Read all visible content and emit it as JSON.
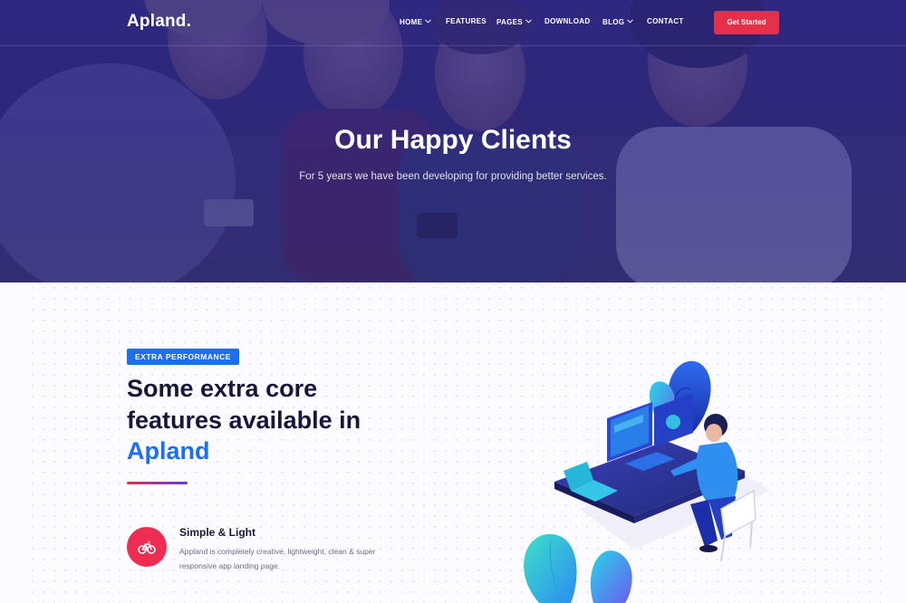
{
  "header": {
    "logo": "Apland.",
    "nav": [
      {
        "label": "HOME",
        "dropdown": true
      },
      {
        "label": "FEATURES",
        "dropdown": false
      },
      {
        "label": "PAGES",
        "dropdown": true
      },
      {
        "label": "DOWNLOAD",
        "dropdown": false
      },
      {
        "label": "BLOG",
        "dropdown": true
      },
      {
        "label": "CONTACT",
        "dropdown": false
      }
    ],
    "cta_label": "Get Started"
  },
  "hero": {
    "title": "Our Happy Clients",
    "subtitle": "For 5 years we have been developing for providing better services."
  },
  "features": {
    "badge": "EXTRA PERFORMANCE",
    "title_line1": "Some extra core",
    "title_line2": "features available in",
    "title_accent": "Apland",
    "card": {
      "icon": "bicycle-icon",
      "title": "Simple & Light",
      "description": "Appland is completely creative, lightweight, clean & super responsive app landing page."
    }
  },
  "colors": {
    "hero_overlay": "#2c268c",
    "accent_blue": "#1d6ff2",
    "accent_red": "#e6304a",
    "heading_dark": "#17173a"
  }
}
